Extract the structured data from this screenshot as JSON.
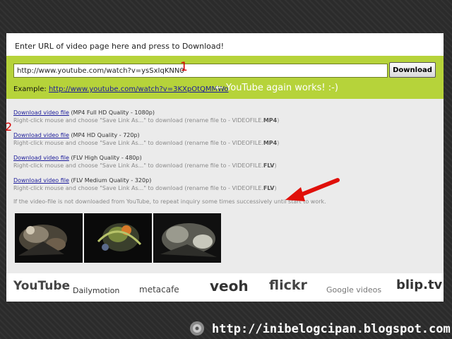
{
  "prompt": "Enter URL of video page here and press to Download!",
  "url_input": {
    "value": "http://www.youtube.com/watch?v=ysSxIqKNN0"
  },
  "markers": {
    "one": "1",
    "two": "2"
  },
  "download_button": "Download",
  "example": {
    "label": "Example:",
    "link": "http://www.youtube.com/watch?v=3KXpOtQMMWo"
  },
  "works_note": "← YouTube again works! :-)",
  "downloads": [
    {
      "link": "Download video file",
      "quality": "(MP4 Full HD Quality - 1080p)",
      "hint": "Right-click mouse and choose \"Save Link As...\" to download (rename file to - VIDEOFILE.",
      "ext": "MP4",
      "close": ")"
    },
    {
      "link": "Download video file",
      "quality": "(MP4 HD Quality - 720p)",
      "hint": "Right-click mouse and choose \"Save Link As...\" to download (rename file to - VIDEOFILE.",
      "ext": "MP4",
      "close": ")"
    },
    {
      "link": "Download video file",
      "quality": "(FLV High Quality - 480p)",
      "hint": "Right-click mouse and choose \"Save Link As...\" to download (rename file to - VIDEOFILE.",
      "ext": "FLV",
      "close": ")"
    },
    {
      "link": "Download video file",
      "quality": "(FLV Medium Quality - 320p)",
      "hint": "Right-click mouse and choose \"Save Link As...\" to download (rename file to - VIDEOFILE.",
      "ext": "FLV",
      "close": ")"
    }
  ],
  "note": "If the video-file is not downloaded from YouTube, to repeat inquiry some times successively until start to work.",
  "logos": {
    "youtube": "YouTube",
    "dailymotion": "Dailymotion",
    "metacafe": "metacafe",
    "veoh": "veoh",
    "flickr": "flickr",
    "google_videos": "Google videos",
    "bliptv": "blip.tv"
  },
  "footer_url": "http://inibelogcipan.blogspot.com",
  "colors": {
    "band": "#b6d33a",
    "marker": "#d40000",
    "link": "#1b1b9a"
  }
}
